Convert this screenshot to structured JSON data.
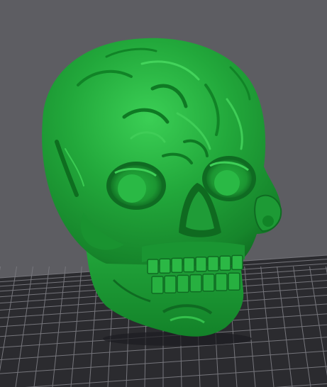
{
  "viewport": {
    "background_color": "#5d5d62",
    "build_plate_color": "#2b2b2f",
    "grid_line_color": "#76767c",
    "model_name": "skull-model",
    "model_color": "#21a33a",
    "model_shadow_color": "#0f6b22",
    "model_highlight_color": "#34c24c"
  }
}
